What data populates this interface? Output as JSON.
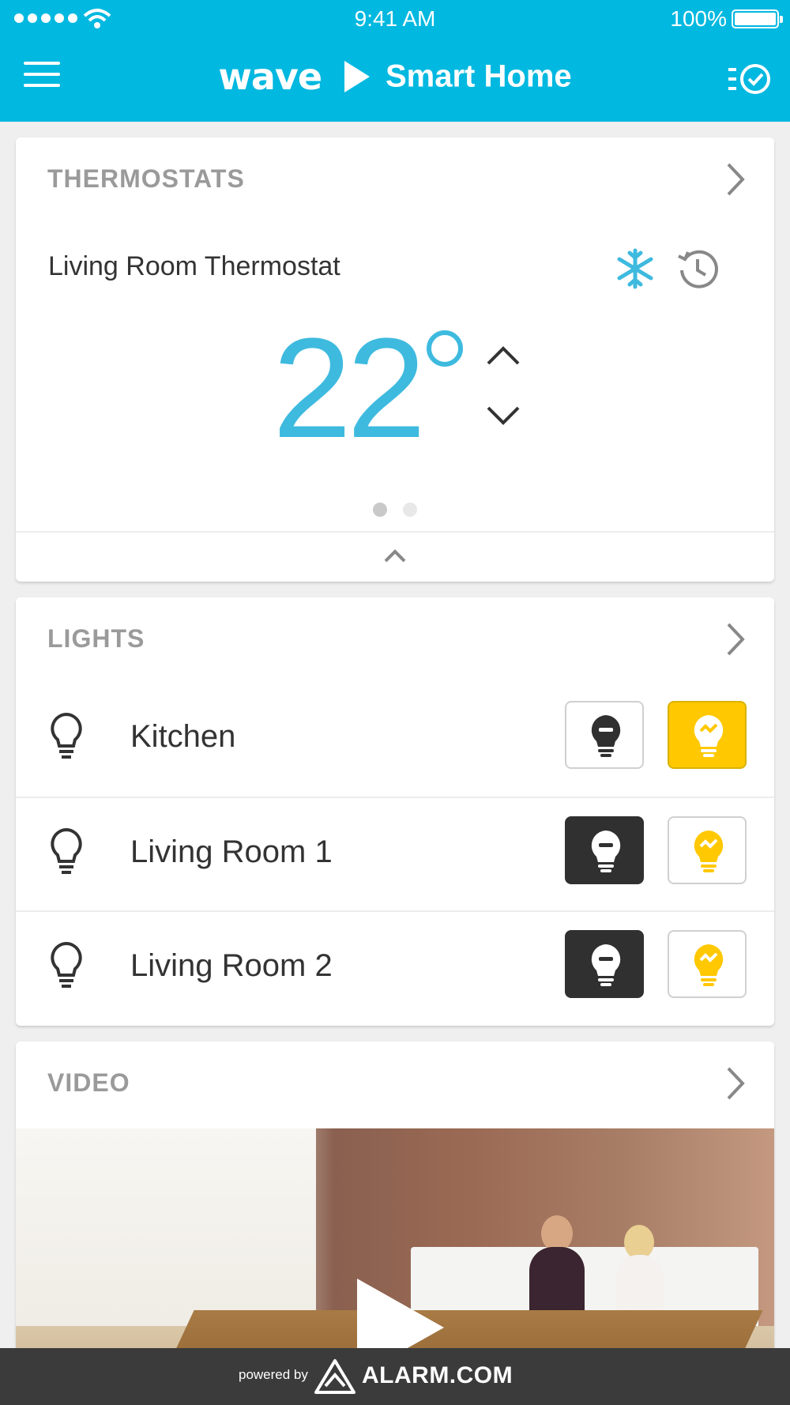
{
  "status_bar": {
    "time": "9:41 AM",
    "battery": "100%"
  },
  "header": {
    "logo": "wave",
    "title": "Smart Home"
  },
  "thermostats": {
    "heading": "THERMOSTATS",
    "device_name": "Living Room Thermostat",
    "temperature": "22",
    "mode_icon": "snowflake-icon",
    "accent_color": "#3ebadf",
    "page_count": 2,
    "active_page": 1
  },
  "lights": {
    "heading": "LIGHTS",
    "items": [
      {
        "label": "Kitchen",
        "state": "on"
      },
      {
        "label": "Living Room 1",
        "state": "off"
      },
      {
        "label": "Living Room 2",
        "state": "off"
      }
    ],
    "on_color": "#ffc800",
    "off_color": "#303030"
  },
  "video": {
    "heading": "VIDEO"
  },
  "footer": {
    "powered_by": "powered by",
    "brand": "ALARM.COM"
  },
  "colors": {
    "header": "#00b8e0",
    "footer": "#3b3b3b"
  }
}
